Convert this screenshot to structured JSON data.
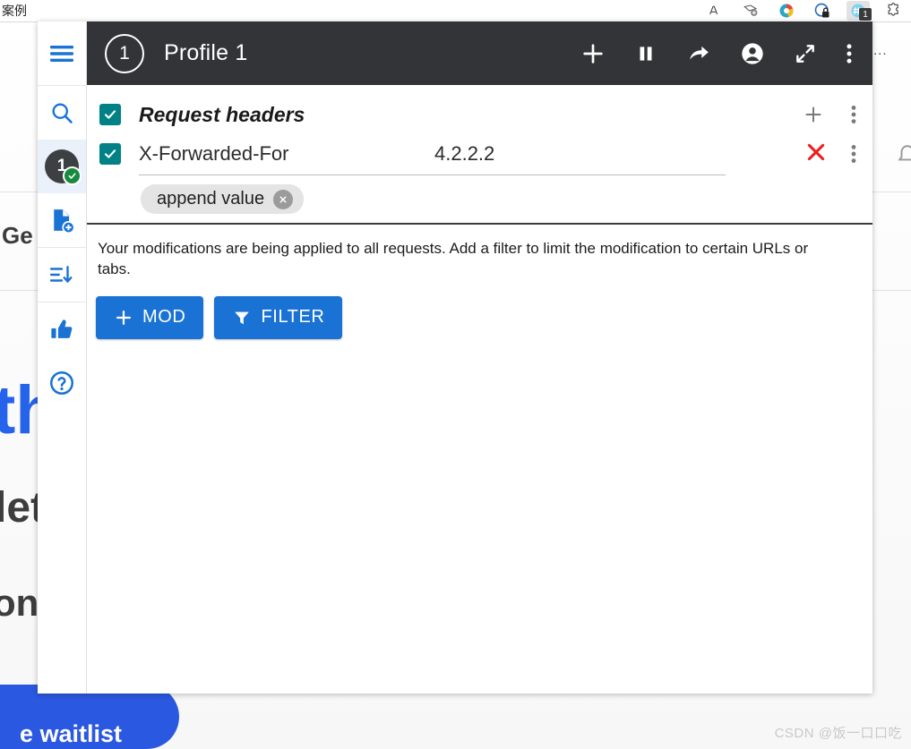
{
  "background": {
    "tab_label": "案例",
    "overflow_dots": "...",
    "extensions": [
      {
        "name": "read-aloud-icon",
        "badge": ""
      },
      {
        "name": "collections-icon",
        "badge": ""
      },
      {
        "name": "browser-profile-icon",
        "badge": ""
      },
      {
        "name": "shield-lock-icon",
        "badge": ""
      },
      {
        "name": "modheader-icon",
        "badge": "1"
      },
      {
        "name": "puzzle-extension-icon",
        "badge": ""
      }
    ],
    "page_fragments": {
      "ge": "Ge",
      "th": "th",
      "let": "let",
      "ong": "ong",
      "cta": "e waitlist"
    },
    "watermark": "CSDN @饭一口口吃"
  },
  "sidebar": {
    "items": [
      {
        "name": "menu-icon",
        "label": "Menu"
      },
      {
        "name": "search-icon",
        "label": "Search"
      },
      {
        "name": "profile-badge",
        "label": "1",
        "selected": true,
        "status": "active"
      },
      {
        "name": "add-profile-icon",
        "label": "Add profile"
      },
      {
        "name": "sort-icon",
        "label": "Sort"
      },
      {
        "name": "thumbs-up-icon",
        "label": "Rate"
      },
      {
        "name": "help-icon",
        "label": "Help"
      }
    ]
  },
  "titlebar": {
    "profile_number": "1",
    "profile_name": "Profile 1",
    "actions": [
      {
        "name": "add-icon",
        "label": "Add"
      },
      {
        "name": "pause-icon",
        "label": "Pause"
      },
      {
        "name": "share-icon",
        "label": "Share"
      },
      {
        "name": "account-icon",
        "label": "Account"
      },
      {
        "name": "expand-icon",
        "label": "Expand"
      },
      {
        "name": "more-vert-icon",
        "label": "More"
      }
    ]
  },
  "mods": {
    "section": {
      "title": "Request headers",
      "enabled": true,
      "add_label": "+",
      "more_label": "More"
    },
    "rows": [
      {
        "enabled": true,
        "name": "X-Forwarded-For",
        "value": "4.2.2.2",
        "chip": "append value",
        "delete_label": "✕"
      }
    ]
  },
  "notice": {
    "text": "Your modifications are being applied to all requests. Add a filter to limit the modification to certain URLs or tabs."
  },
  "buttons": {
    "mod": "MOD",
    "mod_prefix": "+",
    "filter": "FILTER"
  },
  "colors": {
    "accent_blue": "#1a73d4",
    "checkbox_teal": "#008185",
    "titlebar_dark": "#333437",
    "delete_red": "#ee1b1b",
    "status_green": "#178a3f"
  }
}
